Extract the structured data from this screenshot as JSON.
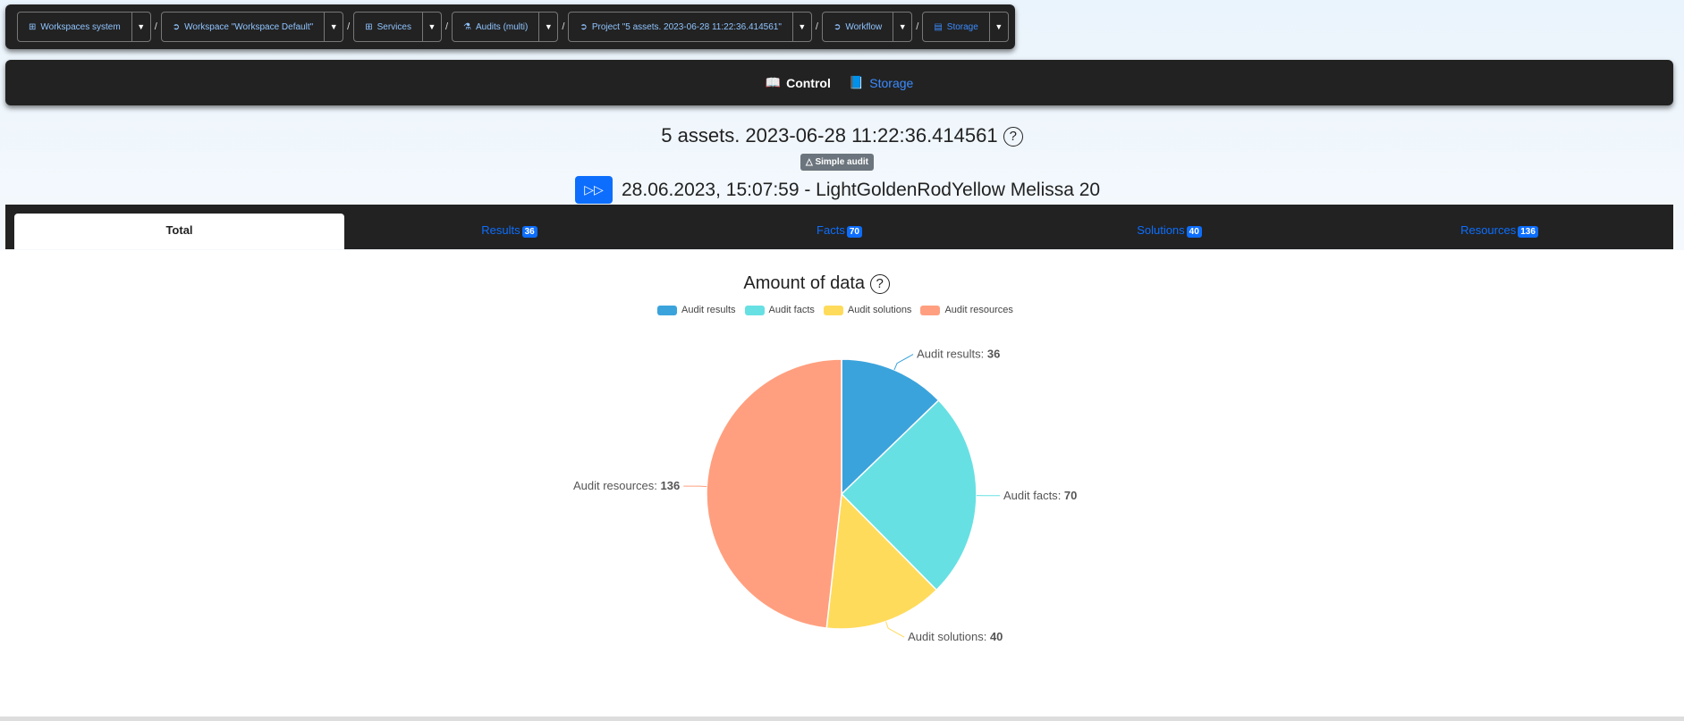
{
  "breadcrumbs": [
    {
      "label": "Workspaces system",
      "icon": "grid-icon"
    },
    {
      "label": "Workspace \"Workspace Default\"",
      "icon": "arrow-circle-icon"
    },
    {
      "label": "Services",
      "icon": "grid-icon"
    },
    {
      "label": "Audits (multi)",
      "icon": "microscope-icon"
    },
    {
      "label": "Project \"5 assets. 2023-06-28 11:22:36.414561\"",
      "icon": "arrow-circle-icon"
    },
    {
      "label": "Workflow",
      "icon": "arrow-circle-icon"
    },
    {
      "label": "Storage",
      "icon": "book-icon",
      "active": true
    }
  ],
  "nav": {
    "control": "Control",
    "storage": "Storage"
  },
  "header": {
    "title": "5 assets. 2023-06-28 11:22:36.414561",
    "help": "?",
    "badge": "Simple audit",
    "subtitle": "28.06.2023, 15:07:59 - LightGoldenRodYellow Melissa 20"
  },
  "tabs": [
    {
      "label": "Total"
    },
    {
      "label": "Results",
      "count": "36"
    },
    {
      "label": "Facts",
      "count": "70"
    },
    {
      "label": "Solutions",
      "count": "40"
    },
    {
      "label": "Resources",
      "count": "136"
    }
  ],
  "chart_data": {
    "type": "pie",
    "title": "Amount of data",
    "legend": "top",
    "categories": [
      "Audit results",
      "Audit facts",
      "Audit solutions",
      "Audit resources"
    ],
    "values": [
      36,
      70,
      40,
      136
    ],
    "colors": [
      "#3ba3dc",
      "#67e0e3",
      "#ffdb5c",
      "#ff9f7f"
    ]
  }
}
